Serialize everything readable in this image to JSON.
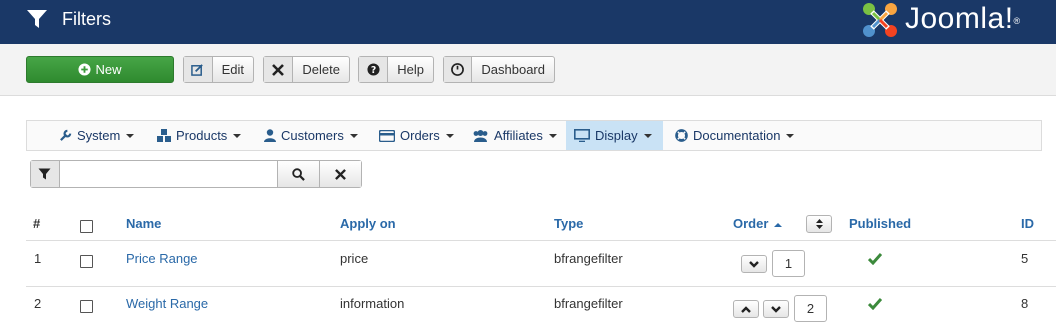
{
  "header": {
    "title": "Filters",
    "logo_text": "Joomla!",
    "logo_reg": "®"
  },
  "toolbar": {
    "new_label": "New",
    "edit_label": "Edit",
    "delete_label": "Delete",
    "help_label": "Help",
    "dashboard_label": "Dashboard"
  },
  "menu": {
    "items": [
      {
        "label": "System",
        "icon": "wrench-icon"
      },
      {
        "label": "Products",
        "icon": "cubes-icon"
      },
      {
        "label": "Customers",
        "icon": "user-icon"
      },
      {
        "label": "Orders",
        "icon": "credit-card-icon"
      },
      {
        "label": "Affiliates",
        "icon": "users-icon"
      },
      {
        "label": "Display",
        "icon": "monitor-icon",
        "active": true
      },
      {
        "label": "Documentation",
        "icon": "lifebuoy-icon"
      }
    ]
  },
  "search": {
    "value": "",
    "placeholder": ""
  },
  "table": {
    "columns": {
      "num": "#",
      "name": "Name",
      "apply_on": "Apply on",
      "type": "Type",
      "order": "Order",
      "published": "Published",
      "id": "ID"
    },
    "rows": [
      {
        "num": "1",
        "name": "Price Range",
        "apply_on": "price",
        "type": "bfrangefilter",
        "order": "1",
        "published": true,
        "id": "5"
      },
      {
        "num": "2",
        "name": "Weight Range",
        "apply_on": "information",
        "type": "bfrangefilter",
        "order": "2",
        "published": true,
        "id": "8"
      }
    ]
  },
  "colors": {
    "header_bg": "#1a3867",
    "new_button": "#3a9a3a",
    "link": "#2a69a8",
    "published_check": "#3c8a3c",
    "active_menu": "#c9e2f5"
  }
}
